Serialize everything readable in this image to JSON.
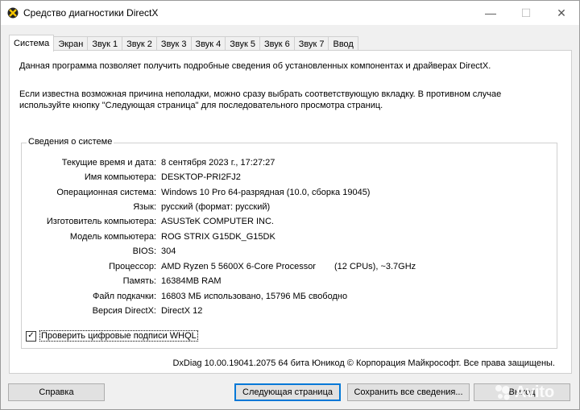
{
  "window": {
    "title": "Средство диагностики DirectX",
    "min_glyph": "—",
    "max_glyph": "☐",
    "close_glyph": "✕"
  },
  "tabs": [
    {
      "label": "Система",
      "active": true
    },
    {
      "label": "Экран"
    },
    {
      "label": "Звук 1"
    },
    {
      "label": "Звук 2"
    },
    {
      "label": "Звук 3"
    },
    {
      "label": "Звук 4"
    },
    {
      "label": "Звук 5"
    },
    {
      "label": "Звук 6"
    },
    {
      "label": "Звук 7"
    },
    {
      "label": "Ввод"
    }
  ],
  "intro": {
    "line1": "Данная программа позволяет получить подробные сведения об установленных компонентах и драйверах DirectX.",
    "line2": "Если известна возможная причина неполадки, можно сразу выбрать соответствующую вкладку. В противном случае используйте кнопку \"Следующая страница\" для последовательного просмотра страниц."
  },
  "system_info": {
    "group_label": "Сведения о системе",
    "rows": [
      {
        "key": "Текущие время и дата:",
        "value": "8 сентября 2023 г., 17:27:27"
      },
      {
        "key": "Имя компьютера:",
        "value": "DESKTOP-PRI2FJ2"
      },
      {
        "key": "Операционная система:",
        "value": "Windows 10 Pro 64-разрядная (10.0, сборка 19045)"
      },
      {
        "key": "Язык:",
        "value": "русский (формат: русский)"
      },
      {
        "key": "Изготовитель компьютера:",
        "value": "ASUSTeK COMPUTER INC."
      },
      {
        "key": "Модель компьютера:",
        "value": "ROG STRIX G15DK_G15DK"
      },
      {
        "key": "BIOS:",
        "value": "304"
      },
      {
        "key": "Процессор:",
        "value": "AMD Ryzen 5 5600X 6-Core Processor",
        "value2": "(12 CPUs), ~3.7GHz"
      },
      {
        "key": "Память:",
        "value": "16384MB RAM"
      },
      {
        "key": "Файл подкачки:",
        "value": "16803 МБ использовано, 15796 МБ свободно"
      },
      {
        "key": "Версия DirectX:",
        "value": "DirectX 12"
      }
    ]
  },
  "whql": {
    "label": "Проверить цифровые подписи WHQL",
    "checked": true,
    "check_glyph": "✓"
  },
  "footer_info": "DxDiag 10.00.19041.2075 64 бита Юникод © Корпорация Майкрософт. Все права защищены.",
  "buttons": {
    "help": "Справка",
    "next": "Следующая страница",
    "save": "Сохранить все сведения...",
    "exit": "Выход"
  },
  "watermark": "Avito"
}
